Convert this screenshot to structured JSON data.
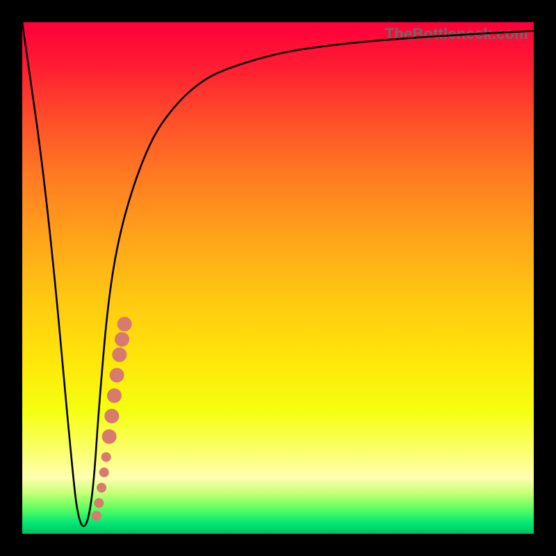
{
  "watermark": "TheBottleneck.com",
  "colors": {
    "curve_stroke": "#000000",
    "marker_fill": "#d87a6e",
    "marker_stroke": "#b86056",
    "frame_bg": "#000000"
  },
  "chart_data": {
    "type": "line",
    "title": "",
    "xlabel": "",
    "ylabel": "",
    "xlim": [
      0,
      100
    ],
    "ylim": [
      0,
      100
    ],
    "series": [
      {
        "name": "bottleneck-curve",
        "x": [
          0,
          5,
          10,
          11,
          12,
          13,
          14,
          15,
          17,
          20,
          25,
          30,
          35,
          40,
          50,
          60,
          70,
          80,
          90,
          100
        ],
        "y": [
          100,
          65,
          10,
          3,
          1,
          3,
          10,
          25,
          48,
          63,
          77,
          84,
          88.5,
          91,
          94,
          95.5,
          96.5,
          97.2,
          97.8,
          98.3
        ]
      }
    ],
    "markers": {
      "name": "highlighted-segment",
      "points": [
        {
          "x": 14.5,
          "y": 3.5,
          "r": 1.0
        },
        {
          "x": 15.0,
          "y": 6.0,
          "r": 1.0
        },
        {
          "x": 15.5,
          "y": 9.0,
          "r": 1.0
        },
        {
          "x": 16.0,
          "y": 12.0,
          "r": 1.0
        },
        {
          "x": 16.4,
          "y": 15.0,
          "r": 1.0
        },
        {
          "x": 17.0,
          "y": 19.0,
          "r": 1.5
        },
        {
          "x": 17.5,
          "y": 23.0,
          "r": 1.5
        },
        {
          "x": 18.0,
          "y": 27.0,
          "r": 1.5
        },
        {
          "x": 18.5,
          "y": 31.0,
          "r": 1.5
        },
        {
          "x": 19.0,
          "y": 35.0,
          "r": 1.5
        },
        {
          "x": 19.5,
          "y": 38.0,
          "r": 1.5
        },
        {
          "x": 20.0,
          "y": 41.0,
          "r": 1.5
        }
      ]
    }
  }
}
